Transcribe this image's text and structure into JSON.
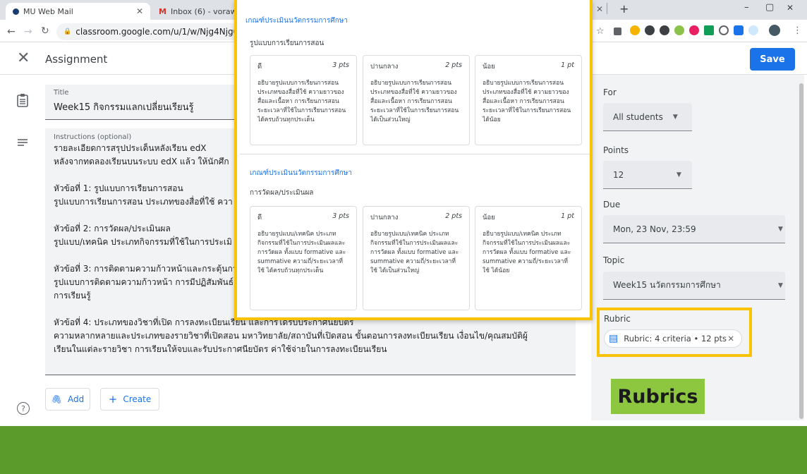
{
  "browser": {
    "tabs": [
      {
        "label": "MU Web Mail"
      },
      {
        "label": "Inbox (6) - vorawan.van@mahi"
      }
    ],
    "url": "classroom.google.com/u/1/w/Njg4Njg0NzEyMDZ",
    "new_tab": "+",
    "win_min": "–",
    "win_max": "▢",
    "win_close": "✕"
  },
  "header": {
    "title": "Assignment",
    "save_label": "Save"
  },
  "form": {
    "title_label": "Title",
    "title_value": "Week15 กิจกรรมแลกเปลี่ยนเรียนรู้",
    "instructions_label": "Instructions (optional)",
    "instructions": [
      "รายละเอียดการสรุปประเด็นหลังเรียน edX\nหลังจากทดลองเรียนบนระบบ edX แล้ว ให้นักศึก",
      "หัวข้อที่ 1: รูปแบบการเรียนการสอน\nรูปแบบการเรียนการสอน ประเภทของสื่อที่ใช้ ควา",
      "หัวข้อที่ 2: การวัดผล/ประเมินผล\nรูปแบบ/เทคนิค ประเภทกิจกรรมที่ใช้ในการประเมิ",
      "หัวข้อที่ 3: การติดตามความก้าวหน้าและกระตุ้นกา\nรูปแบบการติดตามความก้าวหน้า การมีปฏิสัมพันธ์\nการเรียนรู้",
      "หัวข้อที่ 4: ประเภทของวิชาที่เปิด การลงทะเบียนเรียน และการได้รับประกาศนียบัตร\nความหลากหลายและประเภทของรายวิชาที่เปิดสอน มหาวิทยาลัย/สถาบันที่เปิดสอน ขั้นตอนการลงทะเบียนเรียน เงื่อนไข/คุณสมบัติผู้\nเรียนในแต่ละรายวิชา การเรียนให้จบและรับประกาศนียบัตร ค่าใช้จ่ายในการลงทะเบียนเรียน"
    ],
    "add_label": "Add",
    "create_label": "Create"
  },
  "side": {
    "for_label": "For",
    "for_value": "All students",
    "points_label": "Points",
    "points_value": "12",
    "due_label": "Due",
    "due_value": "Mon, 23 Nov, 23:59",
    "topic_label": "Topic",
    "topic_value": "Week15 นวัตกรรมการศึกษา",
    "rubric_label": "Rubric",
    "rubric_chip": "Rubric: 4 criteria • 12 pts"
  },
  "annotation": {
    "rubrics_label": "Rubrics"
  },
  "rubric": {
    "criteria": [
      {
        "heading": "เกณฑ์ประเมินนวัตกรรมการศึกษา",
        "title": "รูปแบบการเรียนการสอน",
        "levels": [
          {
            "name": "ดี",
            "pts": "3 pts",
            "desc": "อธิบายรูปแบบการเรียนการสอน ประเภทของสื่อที่ใช้ ความยาวของสื่อและเนื้อหา การเรียนการสอน ระยะเวลาที่ใช้ในการเรียนการสอน ได้ครบถ้วนทุกประเด็น"
          },
          {
            "name": "ปานกลาง",
            "pts": "2 pts",
            "desc": "อธิบายรูปแบบการเรียนการสอน ประเภทของสื่อที่ใช้ ความยาวของสื่อและเนื้อหา การเรียนการสอน ระยะเวลาที่ใช้ในการเรียนการสอนได้เป็นส่วนใหญ่"
          },
          {
            "name": "น้อย",
            "pts": "1 pt",
            "desc": "อธิบายรูปแบบการเรียนการสอน ประเภทของสื่อที่ใช้ ความยาวของสื่อและเนื้อหา การเรียนการสอน ระยะเวลาที่ใช้ในการเรียนการสอนได้น้อย"
          }
        ]
      },
      {
        "heading": "เกณฑ์ประเมินนวัตกรรมการศึกษา",
        "title": "การวัดผล/ประเมินผล",
        "levels": [
          {
            "name": "ดี",
            "pts": "3 pts",
            "desc": "อธิบายรูปแบบ/เทคนิค ประเภทกิจกรรมที่ใช้ในการประเมินผลและการวัดผล ทั้งแบบ formative และ summative ความถี่/ระยะเวลาที่ใช้ ได้ครบถ้วนทุกประเด็น"
          },
          {
            "name": "ปานกลาง",
            "pts": "2 pts",
            "desc": "อธิบายรูปแบบ/เทคนิค ประเภทกิจกรรมที่ใช้ในการประเมินผลและการวัดผล ทั้งแบบ formative และ summative ความถี่/ระยะเวลาที่ใช้ ได้เป็นส่วนใหญ่"
          },
          {
            "name": "น้อย",
            "pts": "1 pt",
            "desc": "อธิบายรูปแบบ/เทคนิค ประเภทกิจกรรมที่ใช้ในการประเมินผลและการวัดผล ทั้งแบบ formative และ summative ความถี่/ระยะเวลาที่ใช้ ได้น้อย"
          }
        ]
      }
    ]
  }
}
